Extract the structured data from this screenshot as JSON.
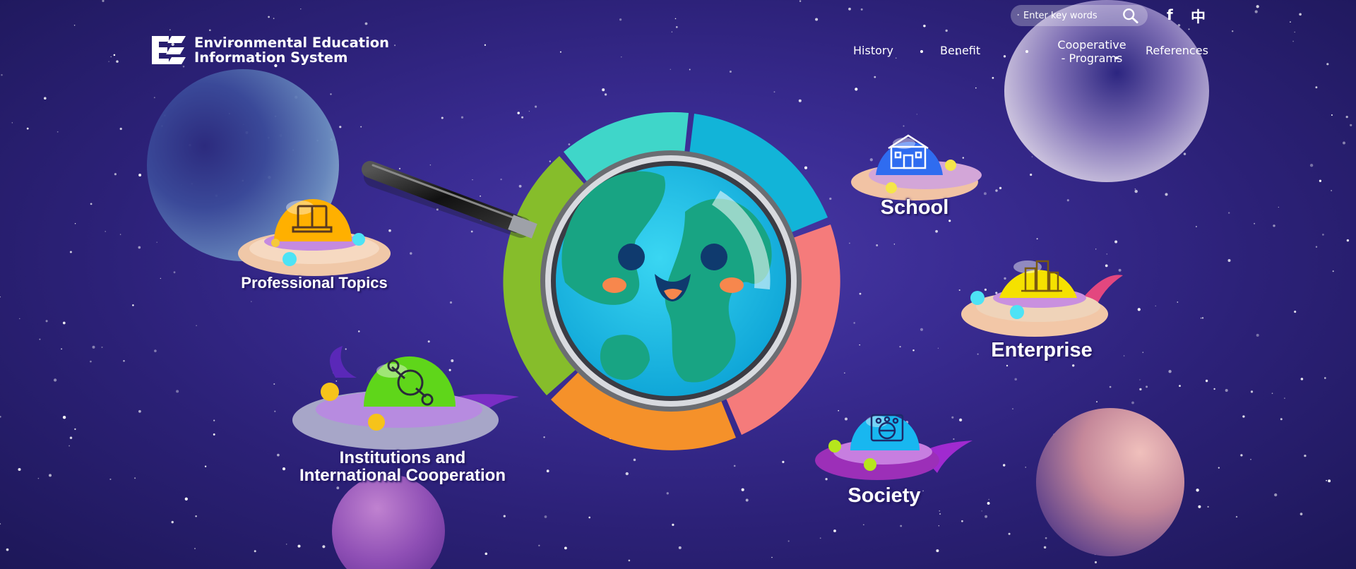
{
  "header": {
    "logo": {
      "line1": "Environmental Education",
      "line2": "Information System"
    },
    "search": {
      "placeholder": "Enter key words"
    },
    "facebook_label": "f",
    "language_label": "中",
    "nav": [
      {
        "label": "History"
      },
      {
        "label": "Benefit"
      },
      {
        "label_line1": "Cooperative",
        "label_line2": "- Programs"
      },
      {
        "label": "References"
      }
    ]
  },
  "categories": [
    {
      "label": "Professional Topics",
      "icon": "book-laptop-icon",
      "dome_color": "#ffb000"
    },
    {
      "label": "School",
      "icon": "school-building-icon",
      "dome_color": "#2f6cf0"
    },
    {
      "label": "Enterprise",
      "icon": "office-buildings-icon",
      "dome_color": "#f5e100"
    },
    {
      "label_line1": "Institutions and",
      "label_line2": "International Cooperation",
      "icon": "handshake-cycle-icon",
      "dome_color": "#5fd61a"
    },
    {
      "label": "Society",
      "icon": "community-globe-icon",
      "dome_color": "#18b7f0"
    }
  ],
  "colors": {
    "background": "#2c2178",
    "ring_teal": "#3fd6c9",
    "ring_cyan": "#12b4d8",
    "ring_pink": "#f57b7b",
    "ring_orange": "#f5912a",
    "ring_green": "#86bd2b"
  }
}
